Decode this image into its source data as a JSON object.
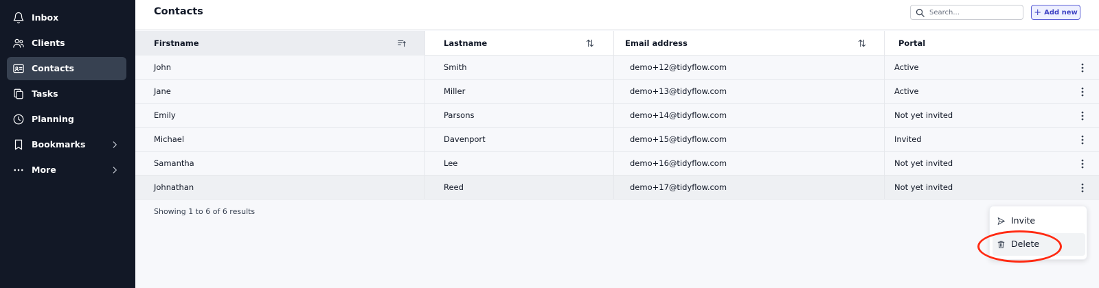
{
  "sidebar": {
    "items": [
      {
        "label": "Inbox",
        "icon": "bell-icon",
        "active": false
      },
      {
        "label": "Clients",
        "icon": "users-icon",
        "active": false
      },
      {
        "label": "Contacts",
        "icon": "id-card-icon",
        "active": true
      },
      {
        "label": "Tasks",
        "icon": "copy-icon",
        "active": false
      },
      {
        "label": "Planning",
        "icon": "clock-icon",
        "active": false
      },
      {
        "label": "Bookmarks",
        "icon": "bookmark-icon",
        "active": false,
        "has_submenu": true
      },
      {
        "label": "More",
        "icon": "ellipsis-icon",
        "active": false,
        "has_submenu": true
      }
    ]
  },
  "header": {
    "title": "Contacts",
    "search_placeholder": "Search...",
    "add_label": "Add new"
  },
  "table": {
    "columns": [
      {
        "label": "Firstname",
        "sort_icon": "sort-active-icon"
      },
      {
        "label": "Lastname",
        "sort_icon": "sort-arrows-icon"
      },
      {
        "label": "Email address",
        "sort_icon": "sort-arrows-icon"
      },
      {
        "label": "Portal",
        "sort_icon": ""
      }
    ],
    "rows": [
      {
        "firstname": "John",
        "lastname": "Smith",
        "email": "demo+12@tidyflow.com",
        "portal": "Active"
      },
      {
        "firstname": "Jane",
        "lastname": "Miller",
        "email": "demo+13@tidyflow.com",
        "portal": "Active"
      },
      {
        "firstname": "Emily",
        "lastname": "Parsons",
        "email": "demo+14@tidyflow.com",
        "portal": "Not yet invited"
      },
      {
        "firstname": "Michael",
        "lastname": "Davenport",
        "email": "demo+15@tidyflow.com",
        "portal": "Invited"
      },
      {
        "firstname": "Samantha",
        "lastname": "Lee",
        "email": "demo+16@tidyflow.com",
        "portal": "Not yet invited"
      },
      {
        "firstname": "Johnathan",
        "lastname": "Reed",
        "email": "demo+17@tidyflow.com",
        "portal": "Not yet invited"
      }
    ],
    "results_text": "Showing 1 to 6 of 6 results"
  },
  "context_menu": {
    "items": [
      {
        "label": "Invite",
        "icon": "send-icon"
      },
      {
        "label": "Delete",
        "icon": "trash-icon"
      }
    ]
  },
  "colors": {
    "sidebar_bg": "#121826",
    "sidebar_active": "#374151",
    "accent": "#5b5fd6",
    "highlight": "#ff2a12"
  }
}
